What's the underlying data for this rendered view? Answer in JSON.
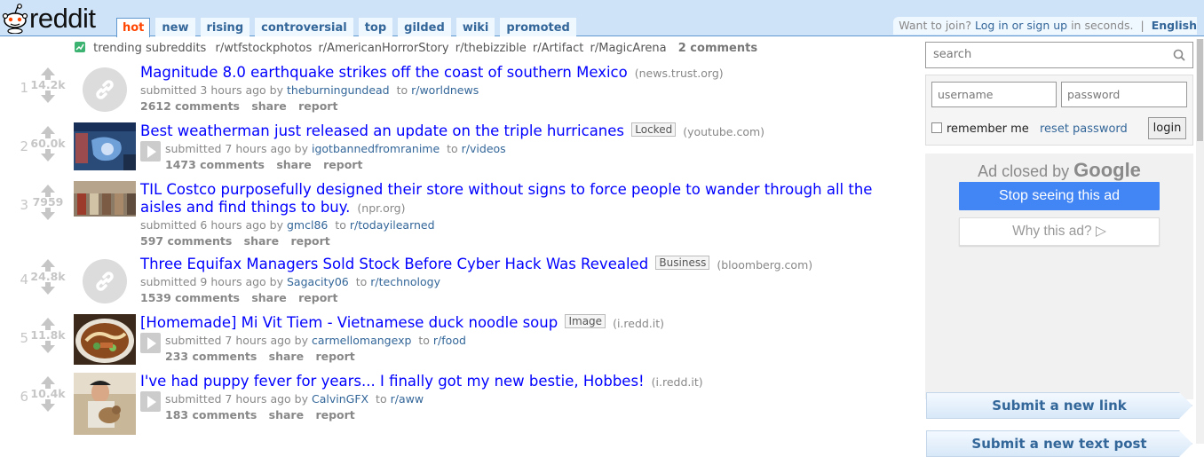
{
  "header": {
    "logo_text": "reddit",
    "tabs": [
      {
        "label": "hot",
        "selected": true
      },
      {
        "label": "new"
      },
      {
        "label": "rising"
      },
      {
        "label": "controversial"
      },
      {
        "label": "top"
      },
      {
        "label": "gilded"
      },
      {
        "label": "wiki"
      },
      {
        "label": "promoted"
      }
    ],
    "join_text": "Want to join?",
    "login_link": "Log in or sign up",
    "join_suffix": "in seconds.",
    "separator": "|",
    "language": "English"
  },
  "trending": {
    "label": "trending subreddits",
    "subreddits": [
      "r/wtfstockphotos",
      "r/AmericanHorrorStory",
      "r/thebizzible",
      "r/Artifact",
      "r/MagicArena"
    ],
    "comments": "2 comments"
  },
  "posts": [
    {
      "rank": "1",
      "score": "14.2k",
      "title": "Magnitude 8.0 earthquake strikes off the coast of southern Mexico",
      "flair": "",
      "domain": "(news.trust.org)",
      "submitted": "submitted 3 hours ago by",
      "author": "theburningundead",
      "to": "to",
      "subreddit": "r/worldnews",
      "comments": "2612 comments",
      "share": "share",
      "report": "report",
      "thumbnail": "link"
    },
    {
      "rank": "2",
      "score": "60.0k",
      "title": "Best weatherman just released an update on the triple hurricanes",
      "flair": "Locked",
      "domain": "(youtube.com)",
      "submitted": "submitted 7 hours ago by",
      "author": "igotbannedfromranime",
      "to": "to",
      "subreddit": "r/videos",
      "comments": "1473 comments",
      "share": "share",
      "report": "report",
      "thumbnail": "weather-map"
    },
    {
      "rank": "3",
      "score": "7959",
      "title": "TIL Costco purposefully designed their store without signs to force people to wander through all the aisles and find things to buy.",
      "flair": "",
      "domain": "(npr.org)",
      "submitted": "submitted 6 hours ago by",
      "author": "gmcl86",
      "to": "to",
      "subreddit": "r/todayilearned",
      "comments": "597 comments",
      "share": "share",
      "report": "report",
      "thumbnail": "warehouse"
    },
    {
      "rank": "4",
      "score": "24.8k",
      "title": "Three Equifax Managers Sold Stock Before Cyber Hack Was Revealed",
      "flair": "Business",
      "domain": "(bloomberg.com)",
      "submitted": "submitted 9 hours ago by",
      "author": "Sagacity06",
      "to": "to",
      "subreddit": "r/technology",
      "comments": "1539 comments",
      "share": "share",
      "report": "report",
      "thumbnail": "link"
    },
    {
      "rank": "5",
      "score": "11.8k",
      "title": "[Homemade] Mi Vit Tiem - Vietnamese duck noodle soup",
      "flair": "Image",
      "domain": "(i.redd.it)",
      "submitted": "submitted 7 hours ago by",
      "author": "carmellomangexp",
      "to": "to",
      "subreddit": "r/food",
      "comments": "233 comments",
      "share": "share",
      "report": "report",
      "thumbnail": "soup"
    },
    {
      "rank": "6",
      "score": "10.4k",
      "title": "I've had puppy fever for years... I finally got my new bestie, Hobbes!",
      "flair": "",
      "domain": "(i.redd.it)",
      "submitted": "submitted 7 hours ago by",
      "author": "CalvinGFX",
      "to": "to",
      "subreddit": "r/aww",
      "comments": "183 comments",
      "share": "share",
      "report": "report",
      "thumbnail": "puppy"
    }
  ],
  "sidebar": {
    "search_placeholder": "search",
    "username_placeholder": "username",
    "password_placeholder": "password",
    "remember_me": "remember me",
    "reset_password": "reset password",
    "login_button": "login",
    "ad_closed_prefix": "Ad closed by",
    "ad_closed_brand": "Google",
    "stop_seeing": "Stop seeing this ad",
    "why_this_ad": "Why this ad?",
    "submit_link": "Submit a new link",
    "submit_text": "Submit a new text post"
  }
}
